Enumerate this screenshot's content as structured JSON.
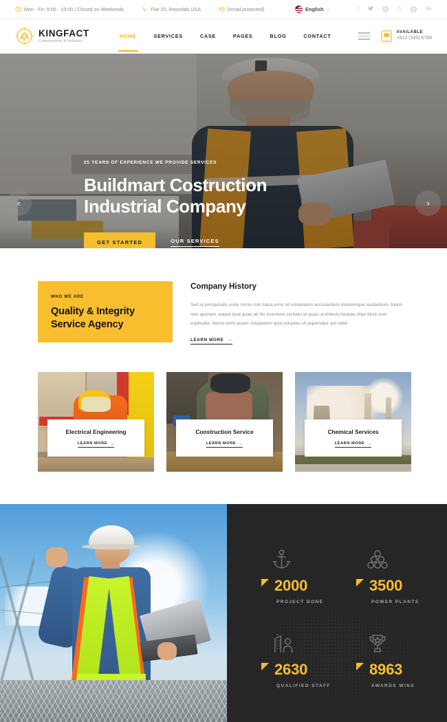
{
  "topbar": {
    "hours": "Mon - Fri: 9:00 - 19:00 / Closed on Weekends",
    "address": "Flat 20, Reynolds USA",
    "email": "[email protected]",
    "language": "English",
    "caret": "⌄",
    "socials": [
      "f",
      "t",
      "ig",
      "G",
      "p",
      "Be"
    ]
  },
  "header": {
    "logo_name": "KINGFACT",
    "logo_tagline": "Construction & Industry",
    "nav": [
      {
        "label": "HOME",
        "active": true
      },
      {
        "label": "SERVICES",
        "active": false
      },
      {
        "label": "CASE",
        "active": false
      },
      {
        "label": "PAGES",
        "active": false
      },
      {
        "label": "BLOG",
        "active": false
      },
      {
        "label": "CONTACT",
        "active": false
      }
    ],
    "call_label": "AVAILABLE",
    "call_number": "+812 (345) 6789"
  },
  "hero": {
    "tagline": "25 YEARS OF EXPERIENCE WE PROVIDE SERVICES",
    "title_line1": "Buildmart Costruction",
    "title_line2": "Industrial Company",
    "primary_button": "GET STARTED",
    "secondary_button": "OUR SERVICES",
    "prev": "‹",
    "next": "›"
  },
  "about": {
    "kicker": "WHO WE ARE",
    "heading_line1": "Quality & Integrity",
    "heading_line2": "Service Agency",
    "title": "Company History",
    "paragraph": "Sed ut perspiciatis unde omnis iste natus error sit voluptatem accusantium doloremque laudantium, totam rem aperiam, eaque ipsa quae ab illo inventore veritatis et quasi architecto beatae vitae dicta sunt explicabo. Nemo enim ipsam voluptatem quia voluptas sit aspernatur aut odite.",
    "learn_more": "LEARN MORE",
    "arrow": "→"
  },
  "services": {
    "learn_more": "LEARN MORE",
    "arrow": "→",
    "cards": [
      {
        "title": "Electrical Engineering"
      },
      {
        "title": "Construction Service"
      },
      {
        "title": "Chemical Services"
      }
    ]
  },
  "counters": [
    {
      "value": "2000",
      "label": "PROJECT DONE",
      "icon": "anchor-icon"
    },
    {
      "value": "3500",
      "label": "POWER PLANTS",
      "icon": "circles-pyramid-icon"
    },
    {
      "value": "2630",
      "label": "QUALIFIED STAFF",
      "icon": "building-person-icon"
    },
    {
      "value": "8963",
      "label": "AWARDS WINS",
      "icon": "trophy-icon"
    }
  ],
  "colors": {
    "accent": "#F5BE2E",
    "dark": "#262626",
    "text": "#1d1d1d",
    "muted": "#8e8e8e"
  }
}
